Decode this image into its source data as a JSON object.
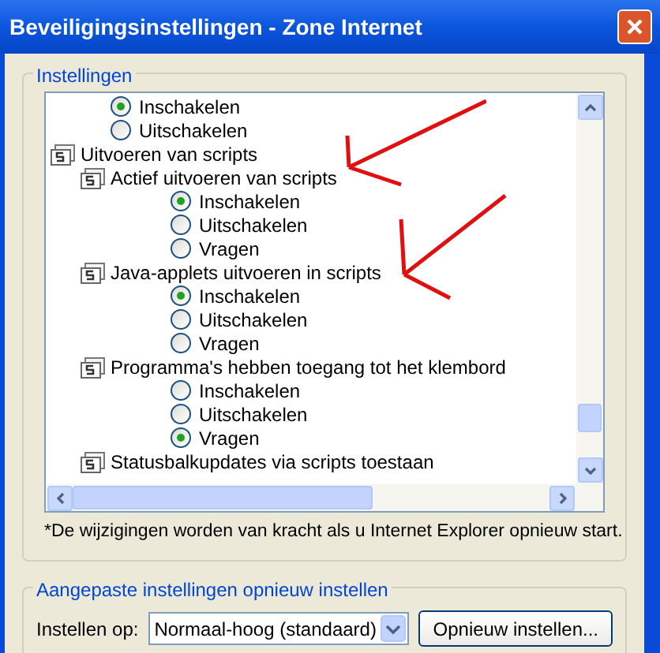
{
  "window": {
    "title": "Beveiligingsinstellingen - Zone Internet"
  },
  "settings_group": {
    "legend": "Instellingen",
    "items": [
      {
        "kind": "radio",
        "label": "Inschakelen",
        "selected": true
      },
      {
        "kind": "radio",
        "label": "Uitschakelen",
        "selected": false
      },
      {
        "kind": "category",
        "label": "Uitvoeren van scripts",
        "children": [
          {
            "kind": "setting",
            "label": "Actief uitvoeren van scripts",
            "children": [
              {
                "kind": "radio",
                "label": "Inschakelen",
                "selected": true
              },
              {
                "kind": "radio",
                "label": "Uitschakelen",
                "selected": false
              },
              {
                "kind": "radio",
                "label": "Vragen",
                "selected": false
              }
            ]
          },
          {
            "kind": "setting",
            "label": "Java-applets uitvoeren in scripts",
            "children": [
              {
                "kind": "radio",
                "label": "Inschakelen",
                "selected": true
              },
              {
                "kind": "radio",
                "label": "Uitschakelen",
                "selected": false
              },
              {
                "kind": "radio",
                "label": "Vragen",
                "selected": false
              }
            ]
          },
          {
            "kind": "setting",
            "label": "Programma's hebben toegang tot het klembord",
            "children": [
              {
                "kind": "radio",
                "label": "Inschakelen",
                "selected": false
              },
              {
                "kind": "radio",
                "label": "Uitschakelen",
                "selected": false
              },
              {
                "kind": "radio",
                "label": "Vragen",
                "selected": true
              }
            ]
          },
          {
            "kind": "setting",
            "label": "Statusbalkupdates via scripts toestaan"
          }
        ]
      }
    ],
    "note": "*De wijzigingen worden van kracht als u Internet Explorer opnieuw start."
  },
  "reset_group": {
    "legend": "Aangepaste instellingen opnieuw instellen",
    "label": "Instellen op:",
    "select_value": "Normaal-hoog (standaard)",
    "button": "Opnieuw instellen..."
  }
}
